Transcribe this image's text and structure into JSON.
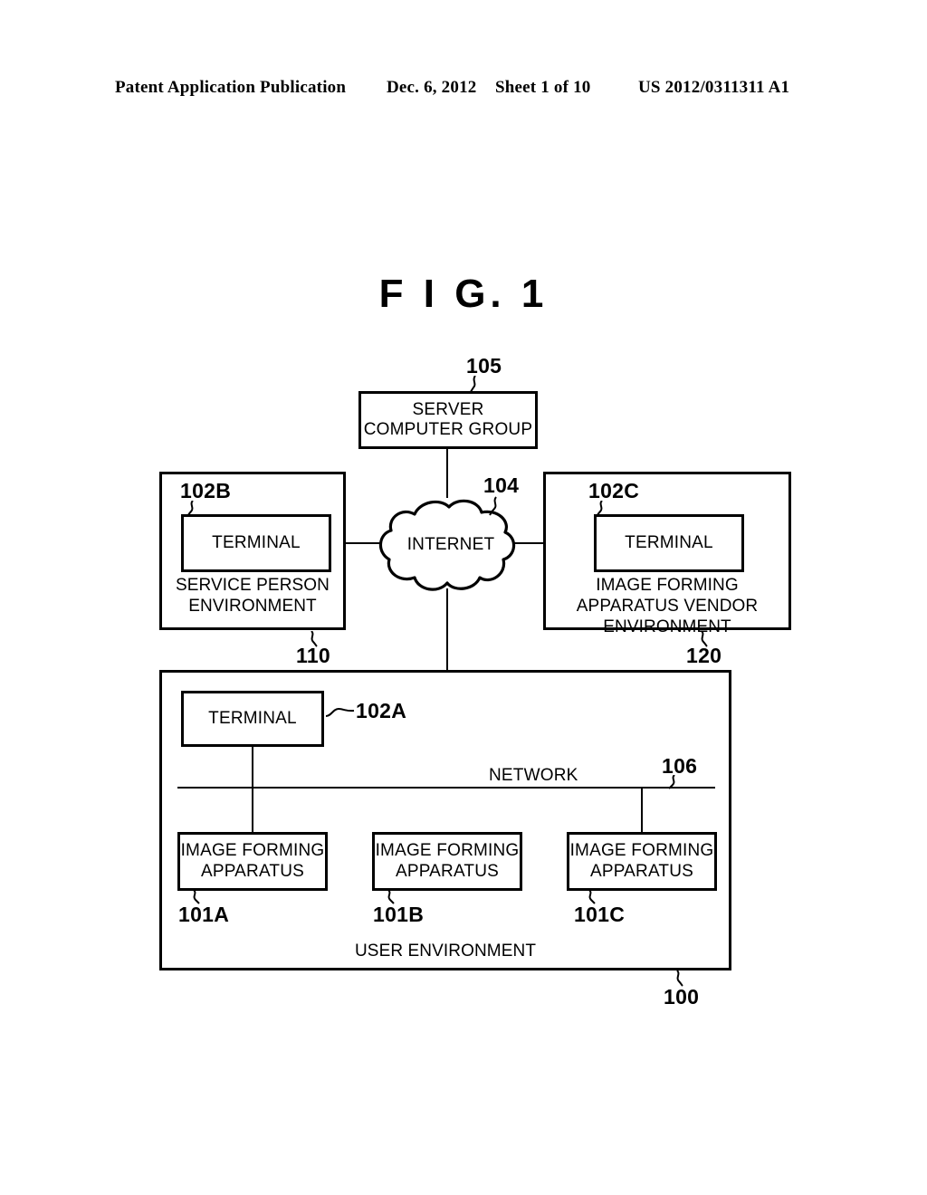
{
  "header": {
    "publication": "Patent Application Publication",
    "date": "Dec. 6, 2012",
    "sheet": "Sheet 1 of 10",
    "number": "US 2012/0311311 A1"
  },
  "figure": {
    "title": "F I G.  1"
  },
  "diagram": {
    "server": {
      "label": "SERVER COMPUTER GROUP",
      "ref": "105"
    },
    "cloud": {
      "label": "INTERNET",
      "ref": "104"
    },
    "service_person_env": {
      "caption": "SERVICE PERSON ENVIRONMENT",
      "ref": "110",
      "terminal": {
        "label": "TERMINAL",
        "ref": "102B"
      }
    },
    "vendor_env": {
      "caption": "IMAGE FORMING APPARATUS VENDOR ENVIRONMENT",
      "ref": "120",
      "terminal": {
        "label": "TERMINAL",
        "ref": "102C"
      }
    },
    "user_env": {
      "caption": "USER ENVIRONMENT",
      "ref": "100",
      "terminal": {
        "label": "TERMINAL",
        "ref": "102A"
      },
      "network": {
        "label": "NETWORK",
        "ref": "106"
      },
      "apparatuses": [
        {
          "label": "IMAGE FORMING APPARATUS",
          "ref": "101A"
        },
        {
          "label": "IMAGE FORMING APPARATUS",
          "ref": "101B"
        },
        {
          "label": "IMAGE FORMING APPARATUS",
          "ref": "101C"
        }
      ]
    }
  },
  "colors": {
    "ink": "#000000",
    "paper": "#ffffff"
  }
}
